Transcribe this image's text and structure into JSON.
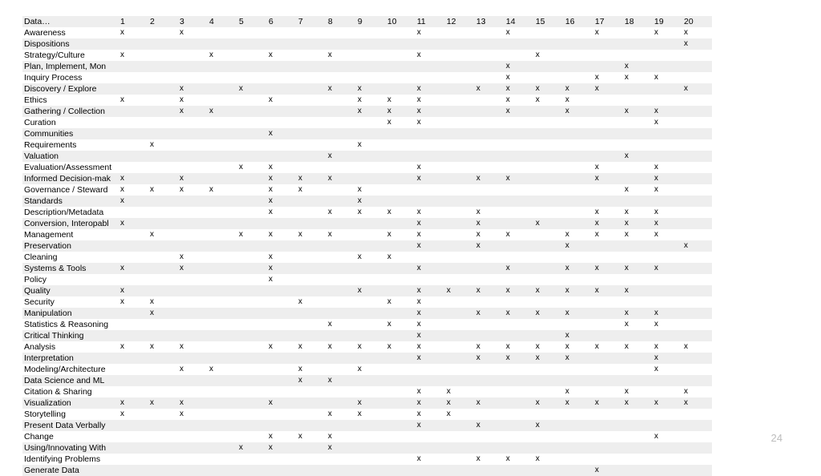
{
  "page_number": "24",
  "columns": [
    "1",
    "2",
    "3",
    "4",
    "5",
    "6",
    "7",
    "8",
    "9",
    "10",
    "11",
    "12",
    "13",
    "14",
    "15",
    "16",
    "17",
    "18",
    "19",
    "20"
  ],
  "row_header_label": "Data…",
  "mark": "x",
  "rows": [
    {
      "label": "Awareness",
      "marks": [
        1,
        0,
        1,
        0,
        0,
        0,
        0,
        0,
        0,
        0,
        1,
        0,
        0,
        1,
        0,
        0,
        1,
        0,
        1,
        1
      ]
    },
    {
      "label": "Dispositions",
      "marks": [
        0,
        0,
        0,
        0,
        0,
        0,
        0,
        0,
        0,
        0,
        0,
        0,
        0,
        0,
        0,
        0,
        0,
        0,
        0,
        1
      ]
    },
    {
      "label": "Strategy/Culture",
      "marks": [
        1,
        0,
        0,
        1,
        0,
        1,
        0,
        1,
        0,
        0,
        1,
        0,
        0,
        0,
        1,
        0,
        0,
        0,
        0,
        0
      ]
    },
    {
      "label": "Plan, Implement, Mon",
      "marks": [
        0,
        0,
        0,
        0,
        0,
        0,
        0,
        0,
        0,
        0,
        0,
        0,
        0,
        1,
        0,
        0,
        0,
        1,
        0,
        0
      ]
    },
    {
      "label": "Inquiry Process",
      "marks": [
        0,
        0,
        0,
        0,
        0,
        0,
        0,
        0,
        0,
        0,
        0,
        0,
        0,
        1,
        0,
        0,
        1,
        1,
        1,
        0
      ]
    },
    {
      "label": "Discovery / Explore",
      "marks": [
        0,
        0,
        1,
        0,
        1,
        0,
        0,
        1,
        1,
        0,
        1,
        0,
        1,
        1,
        1,
        1,
        1,
        0,
        0,
        1
      ]
    },
    {
      "label": "Ethics",
      "marks": [
        1,
        0,
        1,
        0,
        0,
        1,
        0,
        0,
        1,
        1,
        1,
        0,
        0,
        1,
        1,
        1,
        0,
        0,
        0,
        0
      ]
    },
    {
      "label": "Gathering / Collection",
      "marks": [
        0,
        0,
        1,
        1,
        0,
        0,
        0,
        0,
        1,
        1,
        1,
        0,
        0,
        1,
        0,
        1,
        0,
        1,
        1,
        0
      ]
    },
    {
      "label": "Curation",
      "marks": [
        0,
        0,
        0,
        0,
        0,
        0,
        0,
        0,
        0,
        1,
        1,
        0,
        0,
        0,
        0,
        0,
        0,
        0,
        1,
        0
      ]
    },
    {
      "label": "Communities",
      "marks": [
        0,
        0,
        0,
        0,
        0,
        1,
        0,
        0,
        0,
        0,
        0,
        0,
        0,
        0,
        0,
        0,
        0,
        0,
        0,
        0
      ]
    },
    {
      "label": "Requirements",
      "marks": [
        0,
        1,
        0,
        0,
        0,
        0,
        0,
        0,
        1,
        0,
        0,
        0,
        0,
        0,
        0,
        0,
        0,
        0,
        0,
        0
      ]
    },
    {
      "label": "Valuation",
      "marks": [
        0,
        0,
        0,
        0,
        0,
        0,
        0,
        1,
        0,
        0,
        0,
        0,
        0,
        0,
        0,
        0,
        0,
        1,
        0,
        0
      ]
    },
    {
      "label": "Evaluation/Assessment",
      "marks": [
        0,
        0,
        0,
        0,
        1,
        1,
        0,
        0,
        0,
        0,
        1,
        0,
        0,
        0,
        0,
        0,
        1,
        0,
        1,
        0
      ]
    },
    {
      "label": "Informed Decision-mak",
      "marks": [
        1,
        0,
        1,
        0,
        0,
        1,
        1,
        1,
        0,
        0,
        1,
        0,
        1,
        1,
        0,
        0,
        1,
        0,
        1,
        0
      ]
    },
    {
      "label": "Governance / Steward",
      "marks": [
        1,
        1,
        1,
        1,
        0,
        1,
        1,
        0,
        1,
        0,
        0,
        0,
        0,
        0,
        0,
        0,
        0,
        1,
        1,
        0
      ]
    },
    {
      "label": "Standards",
      "marks": [
        1,
        0,
        0,
        0,
        0,
        1,
        0,
        0,
        1,
        0,
        0,
        0,
        0,
        0,
        0,
        0,
        0,
        0,
        0,
        0
      ]
    },
    {
      "label": "Description/Metadata",
      "marks": [
        0,
        0,
        0,
        0,
        0,
        1,
        0,
        1,
        1,
        1,
        1,
        0,
        1,
        0,
        0,
        0,
        1,
        1,
        1,
        0
      ]
    },
    {
      "label": "Conversion, Interopabl",
      "marks": [
        1,
        0,
        0,
        0,
        0,
        0,
        0,
        0,
        0,
        0,
        1,
        0,
        1,
        0,
        1,
        0,
        1,
        1,
        1,
        0
      ]
    },
    {
      "label": "Management",
      "marks": [
        0,
        1,
        0,
        0,
        1,
        1,
        1,
        1,
        0,
        1,
        1,
        0,
        1,
        1,
        0,
        1,
        1,
        1,
        1,
        0
      ]
    },
    {
      "label": "Preservation",
      "marks": [
        0,
        0,
        0,
        0,
        0,
        0,
        0,
        0,
        0,
        0,
        1,
        0,
        1,
        0,
        0,
        1,
        0,
        0,
        0,
        1
      ]
    },
    {
      "label": "Cleaning",
      "marks": [
        0,
        0,
        1,
        0,
        0,
        1,
        0,
        0,
        1,
        1,
        0,
        0,
        0,
        0,
        0,
        0,
        0,
        0,
        0,
        0
      ]
    },
    {
      "label": "Systems & Tools",
      "marks": [
        1,
        0,
        1,
        0,
        0,
        1,
        0,
        0,
        0,
        0,
        1,
        0,
        0,
        1,
        0,
        1,
        1,
        1,
        1,
        0
      ]
    },
    {
      "label": "Policy",
      "marks": [
        0,
        0,
        0,
        0,
        0,
        1,
        0,
        0,
        0,
        0,
        0,
        0,
        0,
        0,
        0,
        0,
        0,
        0,
        0,
        0
      ]
    },
    {
      "label": "Quality",
      "marks": [
        1,
        0,
        0,
        0,
        0,
        0,
        0,
        0,
        1,
        0,
        1,
        1,
        1,
        1,
        1,
        1,
        1,
        1,
        0,
        0
      ]
    },
    {
      "label": "Security",
      "marks": [
        1,
        1,
        0,
        0,
        0,
        0,
        1,
        0,
        0,
        1,
        1,
        0,
        0,
        0,
        0,
        0,
        0,
        0,
        0,
        0
      ]
    },
    {
      "label": "Manipulation",
      "marks": [
        0,
        1,
        0,
        0,
        0,
        0,
        0,
        0,
        0,
        0,
        1,
        0,
        1,
        1,
        1,
        1,
        0,
        1,
        1,
        0
      ]
    },
    {
      "label": "Statistics & Reasoning",
      "marks": [
        0,
        0,
        0,
        0,
        0,
        0,
        0,
        1,
        0,
        1,
        1,
        0,
        0,
        0,
        0,
        0,
        0,
        1,
        1,
        0
      ]
    },
    {
      "label": "Critical Thinking",
      "marks": [
        0,
        0,
        0,
        0,
        0,
        0,
        0,
        0,
        0,
        0,
        1,
        0,
        0,
        0,
        0,
        1,
        0,
        0,
        0,
        0
      ]
    },
    {
      "label": "Analysis",
      "marks": [
        1,
        1,
        1,
        0,
        0,
        1,
        1,
        1,
        1,
        1,
        1,
        0,
        1,
        1,
        1,
        1,
        1,
        1,
        1,
        1
      ]
    },
    {
      "label": "Interpretation",
      "marks": [
        0,
        0,
        0,
        0,
        0,
        0,
        0,
        0,
        0,
        0,
        1,
        0,
        1,
        1,
        1,
        1,
        0,
        0,
        1,
        0
      ]
    },
    {
      "label": "Modeling/Architecture",
      "marks": [
        0,
        0,
        1,
        1,
        0,
        0,
        1,
        0,
        1,
        0,
        0,
        0,
        0,
        0,
        0,
        0,
        0,
        0,
        1,
        0
      ]
    },
    {
      "label": "Data Science and ML",
      "marks": [
        0,
        0,
        0,
        0,
        0,
        0,
        1,
        1,
        0,
        0,
        0,
        0,
        0,
        0,
        0,
        0,
        0,
        0,
        0,
        0
      ]
    },
    {
      "label": "Citation & Sharing",
      "marks": [
        0,
        0,
        0,
        0,
        0,
        0,
        0,
        0,
        0,
        0,
        1,
        1,
        0,
        0,
        0,
        1,
        0,
        1,
        0,
        1
      ]
    },
    {
      "label": "Visualization",
      "marks": [
        1,
        1,
        1,
        0,
        0,
        1,
        0,
        0,
        1,
        0,
        1,
        1,
        1,
        0,
        1,
        1,
        1,
        1,
        1,
        1
      ]
    },
    {
      "label": "Storytelling",
      "marks": [
        1,
        0,
        1,
        0,
        0,
        0,
        0,
        1,
        1,
        0,
        1,
        1,
        0,
        0,
        0,
        0,
        0,
        0,
        0,
        0
      ]
    },
    {
      "label": "Present Data Verbally",
      "marks": [
        0,
        0,
        0,
        0,
        0,
        0,
        0,
        0,
        0,
        0,
        1,
        0,
        1,
        0,
        1,
        0,
        0,
        0,
        0,
        0
      ]
    },
    {
      "label": "Change",
      "marks": [
        0,
        0,
        0,
        0,
        0,
        1,
        1,
        1,
        0,
        0,
        0,
        0,
        0,
        0,
        0,
        0,
        0,
        0,
        1,
        0
      ]
    },
    {
      "label": "Using/Innovating With",
      "marks": [
        0,
        0,
        0,
        0,
        1,
        1,
        0,
        1,
        0,
        0,
        0,
        0,
        0,
        0,
        0,
        0,
        0,
        0,
        0,
        0
      ]
    },
    {
      "label": "Identifying Problems",
      "marks": [
        0,
        0,
        0,
        0,
        0,
        0,
        0,
        0,
        0,
        0,
        1,
        0,
        1,
        1,
        1,
        0,
        0,
        0,
        0,
        0
      ]
    },
    {
      "label": "Generate Data",
      "marks": [
        0,
        0,
        0,
        0,
        0,
        0,
        0,
        0,
        0,
        0,
        0,
        0,
        0,
        0,
        0,
        0,
        1,
        0,
        0,
        0
      ]
    }
  ]
}
